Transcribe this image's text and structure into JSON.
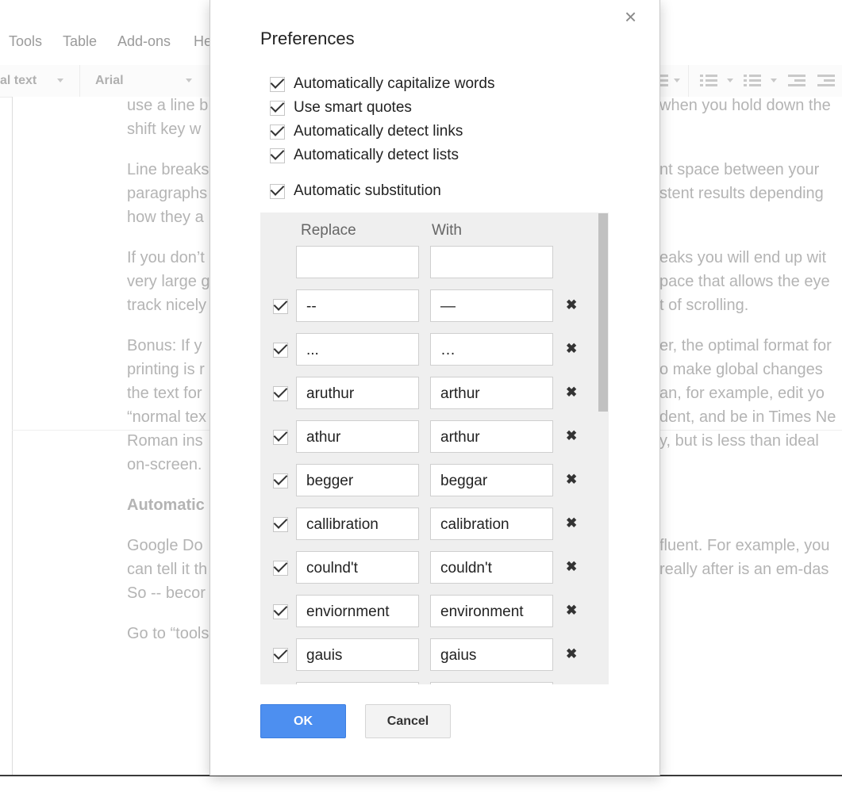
{
  "menu": {
    "tools": "Tools",
    "table": "Table",
    "addons": "Add-ons",
    "help_partial": "He"
  },
  "toolbar": {
    "style_partial": "al text",
    "font": "Arial"
  },
  "document": {
    "left_lines": [
      "use a line b",
      "shift key w",
      "Line breaks",
      "paragraphs",
      "how they a",
      "If you don’t",
      "very large g",
      "track nicely",
      "Bonus: If y",
      "printing is r",
      "the text for",
      "“normal tex",
      "Roman ins",
      "on-screen.",
      "Google Do",
      "can tell it th",
      "So -- becor",
      "Go to “tools"
    ],
    "heading_partial": "Automatic",
    "right_lines": [
      "when you hold down the",
      "nt space between your",
      "stent results depending",
      "eaks you will end up wit",
      "pace that allows the eye",
      "t of scrolling.",
      "er, the optimal format for",
      "o make global changes",
      "an, for example, edit yo",
      "dent, and be in Times Ne",
      "y, but is less than ideal",
      "fluent. For example, you",
      "really after is an em-das"
    ]
  },
  "dialog": {
    "title": "Preferences",
    "close_symbol": "×",
    "options": [
      "Automatically capitalize words",
      "Use smart quotes",
      "Automatically detect links",
      "Automatically detect lists",
      "Automatic substitution"
    ],
    "table": {
      "col_replace": "Replace",
      "col_with": "With",
      "new_replace": "",
      "new_with": "",
      "delete_symbol": "✖",
      "rows": [
        {
          "replace": "--",
          "with": "—"
        },
        {
          "replace": "...",
          "with": "…"
        },
        {
          "replace": "aruthur",
          "with": "arthur"
        },
        {
          "replace": "athur",
          "with": "arthur"
        },
        {
          "replace": "begger",
          "with": "beggar"
        },
        {
          "replace": "callibration",
          "with": "calibration"
        },
        {
          "replace": "coulnd't",
          "with": "couldn't"
        },
        {
          "replace": "enviornment",
          "with": "environment"
        },
        {
          "replace": "gauis",
          "with": "gaius"
        }
      ]
    },
    "ok_label": "OK",
    "cancel_label": "Cancel"
  }
}
